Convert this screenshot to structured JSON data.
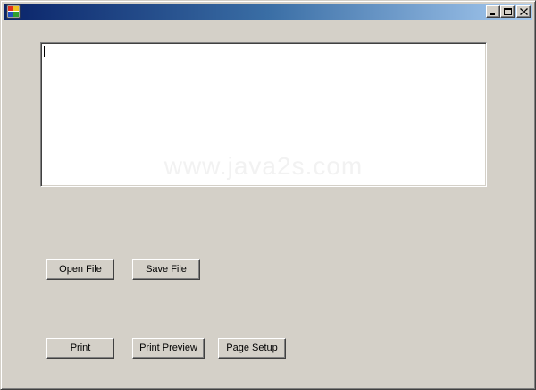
{
  "window": {
    "title": "",
    "icon": "app-form-icon",
    "controls": {
      "minimize_icon": "minimize-icon",
      "maximize_icon": "maximize-icon",
      "close_icon": "close-icon"
    }
  },
  "editor": {
    "value": "",
    "watermark": "www.java2s.com"
  },
  "buttons": {
    "open_file": "Open File",
    "save_file": "Save File",
    "print": "Print",
    "print_preview": "Print Preview",
    "page_setup": "Page Setup"
  },
  "colors": {
    "face": "#d4d0c8",
    "title_start": "#0a246a",
    "title_end": "#a6caf0"
  }
}
